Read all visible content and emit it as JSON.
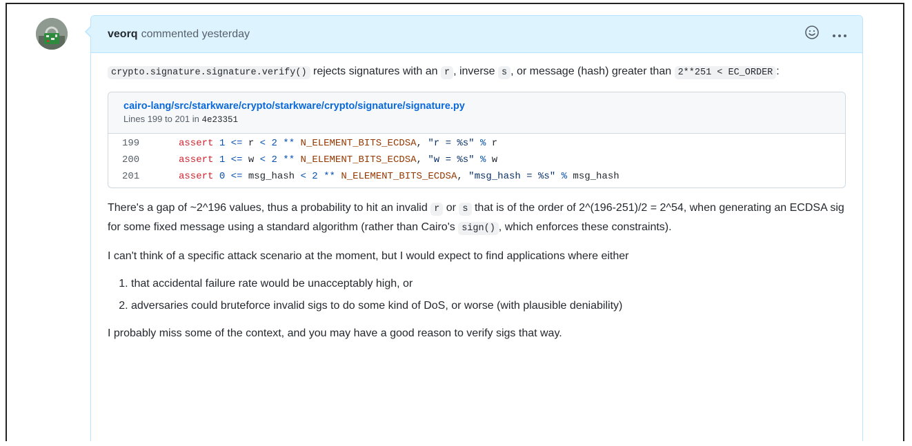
{
  "comment": {
    "author": "veorq",
    "meta": "commented yesterday",
    "p1": {
      "code1": "crypto.signature.signature.verify()",
      "t1": " rejects signatures with an ",
      "code2": "r",
      "t2": ", inverse ",
      "code3": "s",
      "t3": ", or message (hash) greater than ",
      "code4": "2**251 < EC_ORDER",
      "t4": ":"
    },
    "embed": {
      "path": "cairo-lang/src/starkware/crypto/starkware/crypto/signature/signature.py",
      "lines_prefix": "Lines 199 to 201 in ",
      "commit": "4e23351",
      "rows": [
        {
          "ln": "199",
          "kw": "assert",
          "a": "1",
          "b": "<=",
          "c": "r",
          "d": "<",
          "e": "2",
          "f": "**",
          "g": "N_ELEMENT_BITS_ECDSA",
          "h": ",",
          "s": "\"r = %s\"",
          "i": "%",
          "j": "r"
        },
        {
          "ln": "200",
          "kw": "assert",
          "a": "1",
          "b": "<=",
          "c": "w",
          "d": "<",
          "e": "2",
          "f": "**",
          "g": "N_ELEMENT_BITS_ECDSA",
          "h": ",",
          "s": "\"w = %s\"",
          "i": "%",
          "j": "w"
        },
        {
          "ln": "201",
          "kw": "assert",
          "a": "0",
          "b": "<=",
          "c": "msg_hash",
          "d": "<",
          "e": "2",
          "f": "**",
          "g": "N_ELEMENT_BITS_ECDSA",
          "h": ",",
          "s": "\"msg_hash = %s\"",
          "i": "%",
          "j": "msg_hash"
        }
      ]
    },
    "p2": {
      "t1": "There's a gap of ~2^196 values, thus a probability to hit an invalid ",
      "code1": "r",
      "t2": " or ",
      "code2": "s",
      "t3": " that is of the order of 2^(196-251)/2 = 2^54, when generating an ECDSA sig for some fixed message using a standard algorithm (rather than Cairo's ",
      "code3": "sign()",
      "t4": ", which enforces these constraints)."
    },
    "p3": "I can't think of a specific attack scenario at the moment, but I would expect to find applications where either",
    "list": [
      "that accidental failure rate would be unacceptably high, or",
      "adversaries could bruteforce invalid sigs to do some kind of DoS, or worse (with plausible deniability)"
    ],
    "p4": "I probably miss some of the context, and you may have a good reason to verify sigs that way."
  }
}
